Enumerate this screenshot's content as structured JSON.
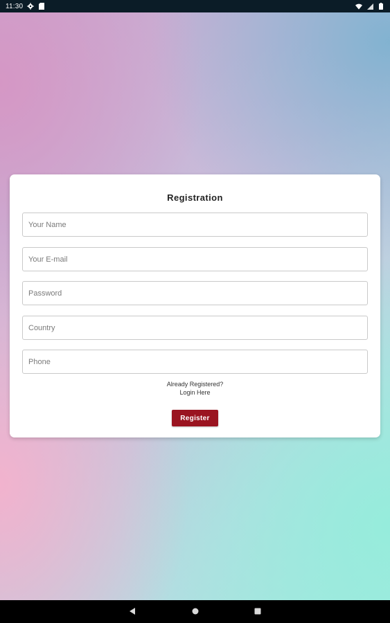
{
  "status_bar": {
    "time": "11:30",
    "icons": [
      "settings-gear-icon",
      "sim-card-icon",
      "wifi-icon",
      "signal-icon",
      "battery-icon"
    ]
  },
  "form": {
    "title": "Registration",
    "fields": {
      "name": {
        "placeholder": "Your Name",
        "value": ""
      },
      "email": {
        "placeholder": "Your E-mail",
        "value": ""
      },
      "password": {
        "placeholder": "Password",
        "value": ""
      },
      "country": {
        "placeholder": "Country",
        "value": ""
      },
      "phone": {
        "placeholder": "Phone",
        "value": ""
      }
    },
    "login_link": {
      "line1": "Already Registered?",
      "line2": "Login Here"
    },
    "register_label": "Register"
  },
  "nav_bar": {
    "icons": [
      "back-icon",
      "home-icon",
      "recents-icon"
    ]
  },
  "colors": {
    "accent": "#9a1420",
    "status_bar": "#0b1c27",
    "nav_bar": "#000000",
    "card": "#ffffff"
  }
}
